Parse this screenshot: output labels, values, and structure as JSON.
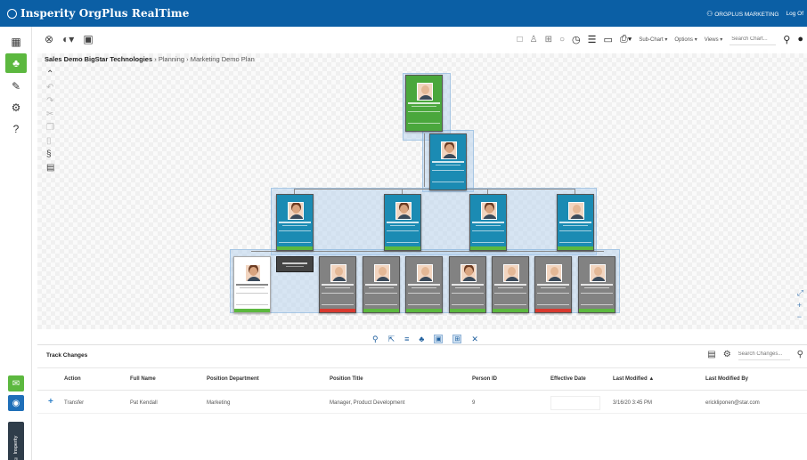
{
  "app": {
    "title": "Insperity OrgPlus RealTime",
    "user": "ORGPLUS MARKETING",
    "logout": "Log Of",
    "brand_color": "#0b5fa5"
  },
  "leftrail": {
    "items": [
      {
        "icon": "grid-icon"
      },
      {
        "icon": "org-chart-icon"
      },
      {
        "icon": "edit-icon"
      },
      {
        "icon": "settings-icon"
      },
      {
        "icon": "help-icon"
      }
    ],
    "vertical_label": "© Insperity"
  },
  "toolbar": {
    "subchart": "Sub-Chart ▾",
    "options": "Options ▾",
    "views": "Views ▾",
    "search_placeholder": "Search Chart..."
  },
  "breadcrumb": {
    "company": "Sales Demo BigStar Technologies",
    "sep1": " › ",
    "planning": "Planning",
    "sep2": " › ",
    "plan": "Marketing Demo Plan"
  },
  "track_changes": {
    "title": "Track Changes",
    "search_placeholder": "Search Changes...",
    "columns": [
      "Action",
      "Full Name",
      "Position Department",
      "Position Title",
      "Person ID",
      "Effective Date",
      "Last Modified ▲",
      "Last Modified By"
    ],
    "rows": [
      {
        "action": "Transfer",
        "full_name": "Pat Kendall",
        "department": "Marketing",
        "title": "Manager, Product Development",
        "person_id": "9",
        "effective_date": "",
        "last_modified": "3/16/20 3:45 PM",
        "modified_by": "erickliponen@star.com"
      }
    ]
  },
  "colors": {
    "accent_green": "#5cb83f",
    "node_teal": "#1b8bb3",
    "node_gray": "#828282",
    "alert_red": "#d9392f"
  }
}
